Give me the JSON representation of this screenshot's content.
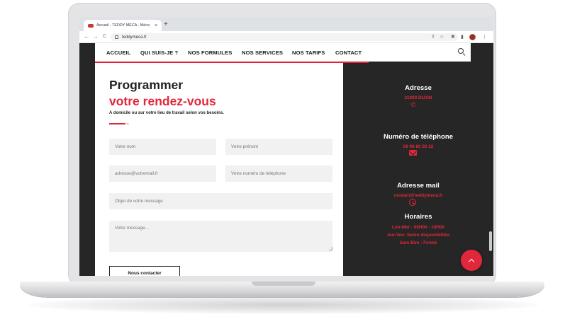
{
  "browser": {
    "tab_title": "Accueil - TEDDY MECA - Méca",
    "tab_close": "×",
    "new_tab": "+",
    "url": "teddymeca.fr",
    "back": "←",
    "forward": "→",
    "reload": "C",
    "share_icon": "⇪",
    "star_icon": "☆",
    "extensions_icon": "✱",
    "sidebar_icon": "▮",
    "menu_icon": "⋮"
  },
  "nav": {
    "items": [
      "ACCUEIL",
      "QUI SUIS-JE ?",
      "NOS FORMULES",
      "NOS SERVICES",
      "NOS TARIFS",
      "CONTACT"
    ]
  },
  "form": {
    "heading_line1": "Programmer",
    "heading_line2": "votre rendez-vous",
    "subtitle": "A domicile ou sur votre lieu de travail selon vos besoins.",
    "name_placeholder": "Votre nom",
    "firstname_placeholder": "Votre prénom",
    "email_placeholder": "adresse@votremail.fr",
    "phone_placeholder": "Votre numéro de téléphone",
    "subject_placeholder": "Objet de votre message",
    "message_placeholder": "Votre message...",
    "submit_label": "Nous contacter"
  },
  "contact_info": {
    "address_title": "Adresse",
    "address_value": "21000 DIJON",
    "phone_title": "Numéro de téléphone",
    "phone_value": "06 98 80 50 22",
    "email_title": "Adresse mail",
    "email_value": "contact@teddymeca.fr",
    "hours_title": "Horaires",
    "hours_line1": "Lun-Mer : 08H00 - 18H00",
    "hours_line2": "Jeu-Ven: Selon disponibilités",
    "hours_line3": "Sam-Dim : Fermé",
    "phone_icon": "✆"
  },
  "colors": {
    "accent": "#e0283a",
    "dark_panel": "#262626"
  }
}
